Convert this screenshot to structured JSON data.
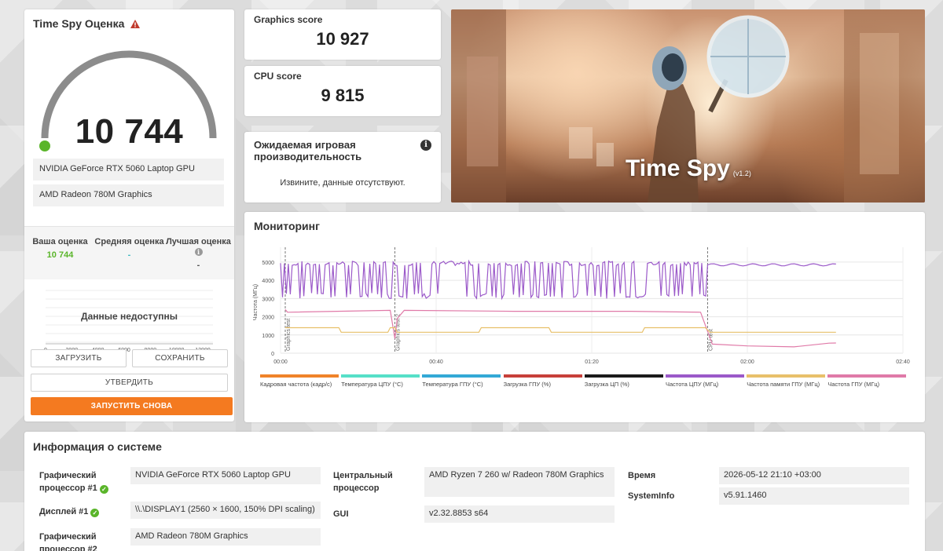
{
  "score": {
    "title": "Time Spy Оценка",
    "value": "10 744",
    "gauge_level": 1.0,
    "gpu_primary": "NVIDIA GeForce RTX 5060 Laptop GPU",
    "gpu_secondary": "AMD Radeon 780M Graphics",
    "stats": [
      {
        "label": "Ваша оценка",
        "value": "10 744"
      },
      {
        "label": "Средняя оценка",
        "value": "-"
      },
      {
        "label": "Лучшая оценка",
        "value": "-"
      }
    ],
    "no_data": "Данные недоступны",
    "dist_ticks": [
      "0",
      "2000",
      "4000",
      "6000",
      "8000",
      "10000",
      "12000"
    ]
  },
  "buttons": {
    "load": "ЗАГРУЗИТЬ",
    "save": "СОХРАНИТЬ",
    "validate": "УТВЕРДИТЬ",
    "run_again": "ЗАПУСТИТЬ СНОВА"
  },
  "graphics_score": {
    "label": "Graphics score",
    "value": "10 927"
  },
  "cpu_score": {
    "label": "CPU score",
    "value": "9 815"
  },
  "expected": {
    "title": "Ожидаемая игровая производительность",
    "message": "Извините, данные отсутствуют."
  },
  "banner": {
    "title": "Time Spy",
    "version": "(v1.2)"
  },
  "monitoring": {
    "title": "Мониторинг",
    "y_label": "Частота (МГц)",
    "y_ticks": [
      "0",
      "1000",
      "2000",
      "3000",
      "4000",
      "5000"
    ],
    "x_ticks": [
      "00:00",
      "00:40",
      "01:20",
      "02:00",
      "02:40"
    ],
    "markers": [
      {
        "label": "Graphics test",
        "t": 0.0
      },
      {
        "label": "Graphics test 2",
        "t": 0.49
      },
      {
        "label": "CPU test",
        "t": 1.83
      }
    ],
    "legend": [
      {
        "label": "Кадровая частота (кадр/с)",
        "color": "#f0832a"
      },
      {
        "label": "Температура ЦПУ (°C)",
        "color": "#56e0c8"
      },
      {
        "label": "Температура ГПУ (°C)",
        "color": "#33a9d6"
      },
      {
        "label": "Загрузка ГПУ (%)",
        "color": "#c7403a"
      },
      {
        "label": "Загрузка ЦП (%)",
        "color": "#1a1a1a"
      },
      {
        "label": "Частота ЦПУ (МГц)",
        "color": "#9b59c9"
      },
      {
        "label": "Частота памяти ГПУ (МГц)",
        "color": "#e8c06a"
      },
      {
        "label": "Частота ГПУ (МГц)",
        "color": "#e07aa8"
      }
    ]
  },
  "sysinfo": {
    "title": "Информация о системе",
    "rows_left": [
      {
        "label": "Графический процессор #1",
        "value": "NVIDIA GeForce RTX 5060 Laptop GPU",
        "ok": true
      },
      {
        "label": "Дисплей #1",
        "value": "\\\\.\\DISPLAY1 (2560 × 1600, 150% DPI scaling)",
        "ok": true
      },
      {
        "label": "Графический процессор #2",
        "value": "AMD Radeon 780M Graphics",
        "ok": false
      }
    ],
    "rows_mid": [
      {
        "label": "Центральный процессор",
        "value": "AMD Ryzen 7 260 w/ Radeon 780M Graphics"
      },
      {
        "label": "GUI",
        "value": "v2.32.8853 s64"
      }
    ],
    "rows_right": [
      {
        "label": "Время",
        "value": "2026-05-12 21:10 +03:00"
      },
      {
        "label": "SystemInfo",
        "value": "v5.91.1460"
      }
    ]
  }
}
